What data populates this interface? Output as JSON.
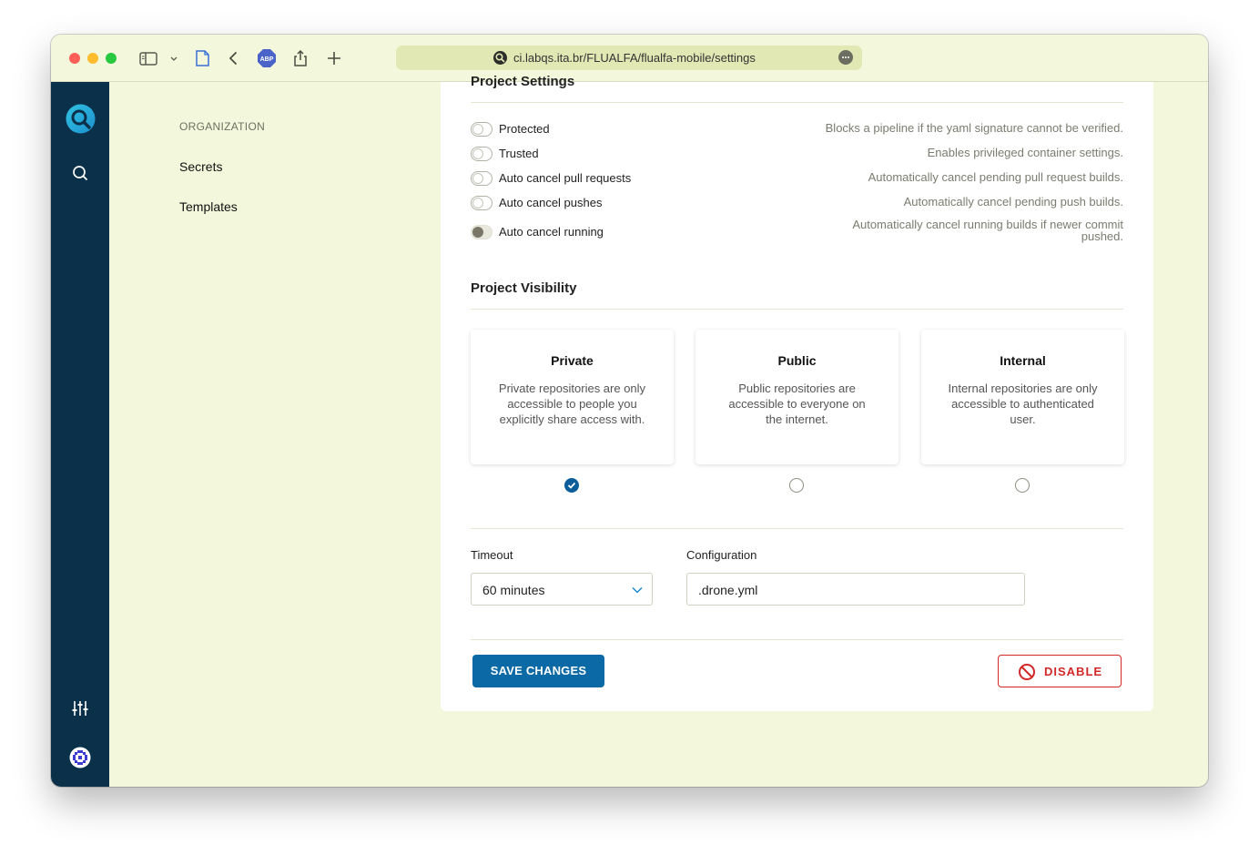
{
  "browser": {
    "url": "ci.labqs.ita.br/FLUALFA/flualfa-mobile/settings"
  },
  "subnav": {
    "heading": "ORGANIZATION",
    "items": [
      {
        "label": "Secrets"
      },
      {
        "label": "Templates"
      }
    ]
  },
  "project_settings": {
    "title": "Project Settings",
    "settings": [
      {
        "label": "Protected",
        "description": "Blocks a pipeline if the yaml signature cannot be verified.",
        "enabled": false
      },
      {
        "label": "Trusted",
        "description": "Enables privileged container settings.",
        "enabled": false
      },
      {
        "label": "Auto cancel pull requests",
        "description": "Automatically cancel pending pull request builds.",
        "enabled": false
      },
      {
        "label": "Auto cancel pushes",
        "description": "Automatically cancel pending push builds.",
        "enabled": false
      },
      {
        "label": "Auto cancel running",
        "description": "Automatically cancel running builds if newer commit pushed.",
        "enabled": true
      }
    ]
  },
  "project_visibility": {
    "title": "Project Visibility",
    "selected": "Private",
    "options": [
      {
        "title": "Private",
        "description": "Private repositories are only accessible to people you explicitly share access with."
      },
      {
        "title": "Public",
        "description": "Public repositories are accessible to everyone on the internet."
      },
      {
        "title": "Internal",
        "description": "Internal repositories are only accessible to authenticated user."
      }
    ]
  },
  "form": {
    "timeout_label": "Timeout",
    "timeout_value": "60 minutes",
    "configuration_label": "Configuration",
    "configuration_value": ".drone.yml"
  },
  "actions": {
    "save_label": "SAVE CHANGES",
    "disable_label": "DISABLE"
  },
  "colors": {
    "accent": "#0b6aa6",
    "danger": "#d42828",
    "sidebar": "#0b3049",
    "page_bg": "#f3f7dc"
  }
}
